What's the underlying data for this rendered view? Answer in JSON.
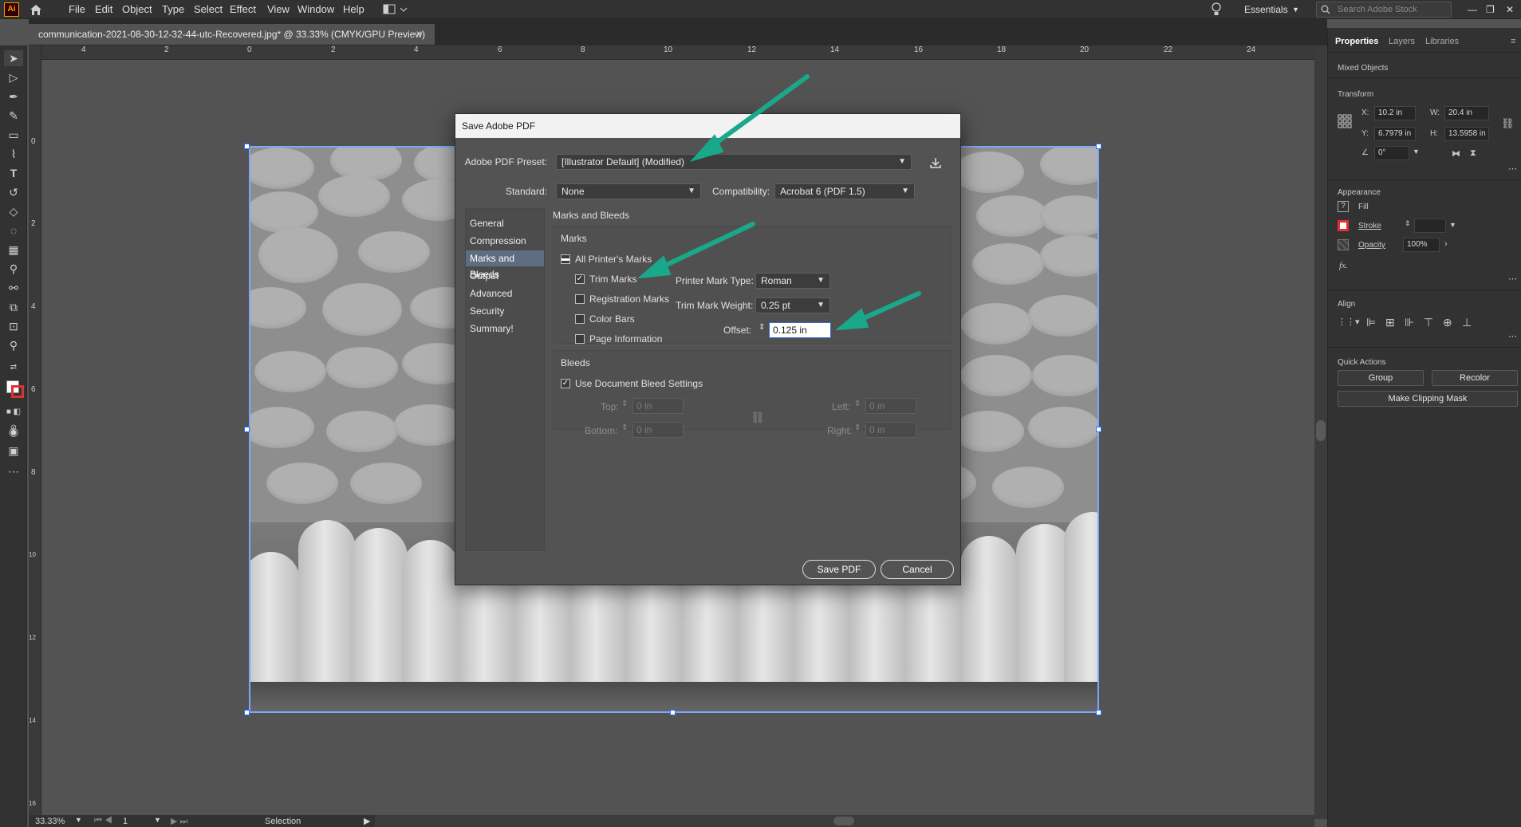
{
  "app": {
    "logo": "Ai"
  },
  "menu": [
    "File",
    "Edit",
    "Object",
    "Type",
    "Select",
    "Effect",
    "View",
    "Window",
    "Help"
  ],
  "workspace": "Essentials",
  "stock_search": {
    "placeholder": "Search Adobe Stock"
  },
  "document_tab": {
    "title": "communication-2021-08-30-12-32-44-utc-Recovered.jpg* @ 33.33% (CMYK/GPU Preview)",
    "close": "×"
  },
  "ruler_top": [
    "4",
    "2",
    "0",
    "2",
    "4",
    "6",
    "8",
    "10",
    "12",
    "14",
    "16",
    "18",
    "20",
    "22",
    "24"
  ],
  "ruler_left": [
    "0",
    "2",
    "4",
    "6",
    "8",
    "10",
    "12",
    "14",
    "16"
  ],
  "status": {
    "zoom": "33.33%",
    "page": "1",
    "tool": "Selection"
  },
  "dialog": {
    "title": "Save Adobe PDF",
    "preset_label": "Adobe PDF Preset:",
    "preset_value": "[Illustrator Default] (Modified)",
    "standard_label": "Standard:",
    "standard_value": "None",
    "compat_label": "Compatibility:",
    "compat_value": "Acrobat 6 (PDF 1.5)",
    "nav": [
      "General",
      "Compression",
      "Marks and Bleeds",
      "Output",
      "Advanced",
      "Security",
      "Summary!"
    ],
    "active_nav": "Marks and Bleeds",
    "section_title": "Marks and Bleeds",
    "marks": {
      "title": "Marks",
      "all_printers": "All Printer's Marks",
      "trim": "Trim Marks",
      "registration": "Registration Marks",
      "color_bars": "Color Bars",
      "page_info": "Page Information",
      "mark_type_label": "Printer Mark Type:",
      "mark_type_value": "Roman",
      "weight_label": "Trim Mark Weight:",
      "weight_value": "0.25 pt",
      "offset_label": "Offset:",
      "offset_value": "0.125 in"
    },
    "bleeds": {
      "title": "Bleeds",
      "use_doc": "Use Document Bleed Settings",
      "top_label": "Top:",
      "top_value": "0 in",
      "bottom_label": "Bottom:",
      "bottom_value": "0 in",
      "left_label": "Left:",
      "left_value": "0 in",
      "right_label": "Right:",
      "right_value": "0 in"
    },
    "save_button": "Save PDF",
    "cancel_button": "Cancel"
  },
  "properties": {
    "tabs": [
      "Properties",
      "Layers",
      "Libraries"
    ],
    "selection": "Mixed Objects",
    "transform": {
      "title": "Transform",
      "x_label": "X:",
      "x": "10.2 in",
      "y_label": "Y:",
      "y": "6.7979 in",
      "w_label": "W:",
      "w": "20.4 in",
      "h_label": "H:",
      "h": "13.5958 in",
      "angle": "0°"
    },
    "appearance": {
      "title": "Appearance",
      "fill": "Fill",
      "stroke": "Stroke",
      "opacity_label": "Opacity",
      "opacity": "100%",
      "fx": "fx."
    },
    "align_title": "Align",
    "quick_actions": {
      "title": "Quick Actions",
      "group": "Group",
      "recolor": "Recolor",
      "clipping": "Make Clipping Mask"
    }
  },
  "colors": {
    "arrow": "#1aa88a",
    "selection": "#7ea5ff",
    "accent": "#ff9a00"
  }
}
